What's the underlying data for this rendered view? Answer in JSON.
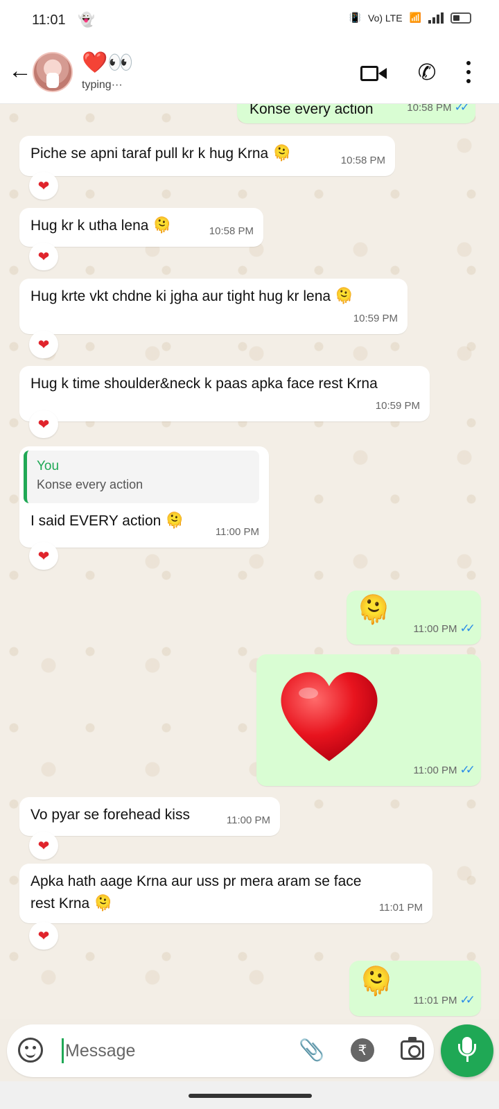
{
  "status_bar": {
    "time": "11:01",
    "network": "Vo) LTE"
  },
  "header": {
    "contact_name": "❤️👀",
    "contact_status": "typing···"
  },
  "messages": [
    {
      "id": "m0",
      "direction": "out",
      "text": "Konse every action",
      "time": "10:58 PM"
    },
    {
      "id": "m1",
      "direction": "in",
      "text": "Piche se apni taraf pull kr k hug Krna",
      "emoji": "🫠",
      "time": "10:58 PM",
      "reaction": "❤"
    },
    {
      "id": "m2",
      "direction": "in",
      "text": "Hug kr k utha lena",
      "emoji": "🫠",
      "time": "10:58 PM",
      "reaction": "❤"
    },
    {
      "id": "m3",
      "direction": "in",
      "text": "Hug krte vkt chdne ki jgha aur tight hug kr lena",
      "emoji": "🫠",
      "time": "10:59 PM",
      "reaction": "❤"
    },
    {
      "id": "m4",
      "direction": "in",
      "text": "Hug k time shoulder&neck k paas apka face rest Krna",
      "time": "10:59 PM",
      "reaction": "❤"
    },
    {
      "id": "m5",
      "direction": "in",
      "quote_author": "You",
      "quote_text": "Konse every action",
      "text": "I said EVERY action",
      "emoji": "🫠",
      "time": "11:00 PM",
      "reaction": "❤"
    },
    {
      "id": "m6",
      "direction": "out",
      "emoji": "🫠",
      "time": "11:00 PM"
    },
    {
      "id": "m7",
      "direction": "out",
      "emoji": "❤",
      "time": "11:00 PM"
    },
    {
      "id": "m8",
      "direction": "in",
      "text": "Vo pyar se forehead kiss",
      "time": "11:00 PM",
      "reaction": "❤"
    },
    {
      "id": "m9",
      "direction": "in",
      "text_line1": "Apka hath aage Krna aur uss pr mera aram se face",
      "text_line2": "rest Krna",
      "emoji": "🫠",
      "time": "11:01 PM",
      "reaction": "❤"
    },
    {
      "id": "m10",
      "direction": "out",
      "emoji": "🫠",
      "time": "11:01 PM"
    }
  ],
  "read_ticks": "✓✓",
  "composer": {
    "placeholder": "Message",
    "rupee_symbol": "₹"
  },
  "colors": {
    "incoming_bubble": "#ffffff",
    "outgoing_bubble": "#d9fdd3",
    "accent_green": "#1fa855",
    "read_tick_blue": "#2a8ce8",
    "reaction_heart": "#e0242c"
  },
  "icons": [
    "back-arrow-icon",
    "video-call-icon",
    "phone-icon",
    "more-menu-icon",
    "emoji-icon",
    "attach-icon",
    "rupee-icon",
    "camera-icon",
    "mic-icon"
  ]
}
